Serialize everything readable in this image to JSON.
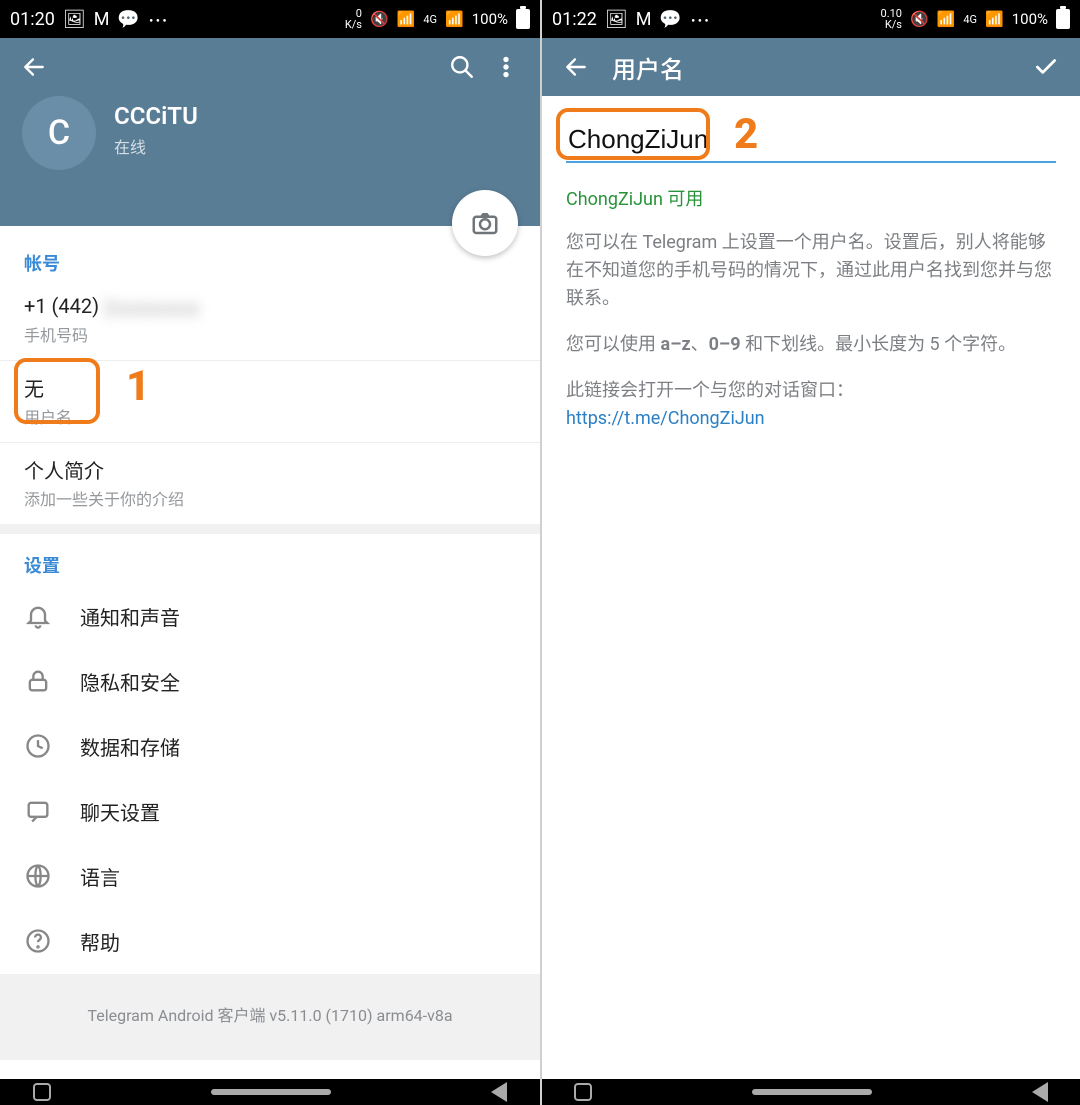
{
  "colors": {
    "brand": "#5a7d96",
    "accent": "#4ca3df",
    "highlight": "#ef7b1a"
  },
  "left": {
    "status": {
      "time": "01:20",
      "ks": "0\nK/s",
      "net": "4G",
      "battery": "100%"
    },
    "profile": {
      "avatar_letter": "C",
      "name": "CCCiTU",
      "status": "在线"
    },
    "account": {
      "header": "帐号",
      "phone_prefix": "+1 (442) ",
      "phone_rest_blur": "2xxxxxxx",
      "phone_sub": "手机号码",
      "username_value": "无",
      "username_sub": "用户名",
      "bio_title": "个人简介",
      "bio_sub": "添加一些关于你的介绍"
    },
    "settings": {
      "header": "设置",
      "items": [
        {
          "icon": "bell",
          "label": "通知和声音"
        },
        {
          "icon": "lock",
          "label": "隐私和安全"
        },
        {
          "icon": "clock",
          "label": "数据和存储"
        },
        {
          "icon": "chat",
          "label": "聊天设置"
        },
        {
          "icon": "globe",
          "label": "语言"
        },
        {
          "icon": "help",
          "label": "帮助"
        }
      ]
    },
    "version": "Telegram Android 客户端 v5.11.0 (1710) arm64-v8a",
    "annotation": "1"
  },
  "right": {
    "status": {
      "time": "01:22",
      "ks": "0.10\nK/s",
      "net": "4G",
      "battery": "100%"
    },
    "header_title": "用户名",
    "input_value": "ChongZiJun",
    "available_text": "ChongZiJun 可用",
    "desc1": "您可以在 Telegram 上设置一个用户名。设置后，别人将能够在不知道您的手机号码的情况下，通过此用户名找到您并与您联系。",
    "desc2_pre": "您可以使用 ",
    "desc2_bold1": "a–z",
    "desc2_mid1": "、",
    "desc2_bold2": "0–9",
    "desc2_mid2": " 和下划线。最小长度为 5 个字符。",
    "link_intro": "此链接会打开一个与您的对话窗口：",
    "link": "https://t.me/ChongZiJun",
    "annotation": "2"
  }
}
